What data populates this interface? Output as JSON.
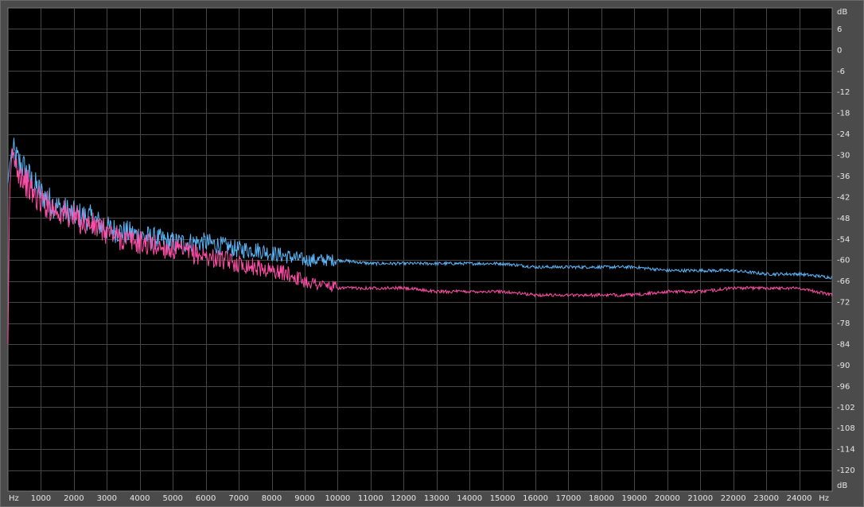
{
  "chart_data": {
    "type": "line",
    "x_unit_label": "Hz",
    "y_unit_label": "dB",
    "xlim": [
      0,
      25000
    ],
    "ylim": [
      -126,
      12
    ],
    "x_ticks": [
      1000,
      2000,
      3000,
      4000,
      5000,
      6000,
      7000,
      8000,
      9000,
      10000,
      11000,
      12000,
      13000,
      14000,
      15000,
      16000,
      17000,
      18000,
      19000,
      20000,
      21000,
      22000,
      23000,
      24000
    ],
    "y_ticks": [
      6,
      0,
      -6,
      -12,
      -18,
      -24,
      -30,
      -36,
      -42,
      -48,
      -54,
      -60,
      -66,
      -72,
      -78,
      -84,
      -90,
      -96,
      -102,
      -108,
      -114,
      -120
    ],
    "grid": true,
    "colors": {
      "background": "#000000",
      "grid": "#474747",
      "frame": "#4b4b4b",
      "text": "#e6e6e6"
    },
    "series": [
      {
        "color": "#5ab4f5",
        "x": [
          0,
          50,
          100,
          150,
          250,
          500,
          750,
          1000,
          1500,
          2000,
          2500,
          3000,
          3500,
          4000,
          4500,
          5000,
          5500,
          6000,
          6500,
          7000,
          7500,
          8000,
          8500,
          9000,
          9500,
          10000,
          11000,
          12000,
          13000,
          14000,
          15000,
          16000,
          17000,
          18000,
          19000,
          20000,
          21000,
          22000,
          23000,
          24000,
          25000
        ],
        "y": [
          -38,
          -33,
          -30,
          -29,
          -31,
          -34,
          -38,
          -41,
          -45,
          -47,
          -48,
          -51,
          -52,
          -53,
          -54,
          -55,
          -55,
          -55,
          -56,
          -57,
          -57,
          -58,
          -59,
          -60,
          -60,
          -60,
          -61,
          -61,
          -61,
          -61,
          -61,
          -62,
          -62,
          -62,
          -62,
          -63,
          -63,
          -63,
          -64,
          -64,
          -65
        ]
      },
      {
        "color": "#ff4da6",
        "x": [
          0,
          50,
          100,
          150,
          250,
          500,
          750,
          1000,
          1500,
          2000,
          2500,
          3000,
          3500,
          4000,
          4500,
          5000,
          5500,
          6000,
          6500,
          7000,
          7500,
          8000,
          8500,
          9000,
          9500,
          10000,
          11000,
          12000,
          13000,
          14000,
          15000,
          16000,
          17000,
          18000,
          19000,
          20000,
          21000,
          22000,
          23000,
          24000,
          25000
        ],
        "y": [
          -84,
          -40,
          -33,
          -31,
          -33,
          -37,
          -41,
          -43,
          -46,
          -48,
          -50,
          -52,
          -54,
          -55,
          -56,
          -57,
          -58,
          -59,
          -60,
          -61,
          -62,
          -63,
          -64,
          -66,
          -67,
          -68,
          -68,
          -68,
          -69,
          -69,
          -69,
          -70,
          -70,
          -70,
          -70,
          -69,
          -69,
          -68,
          -68,
          -68,
          -70
        ]
      }
    ]
  }
}
